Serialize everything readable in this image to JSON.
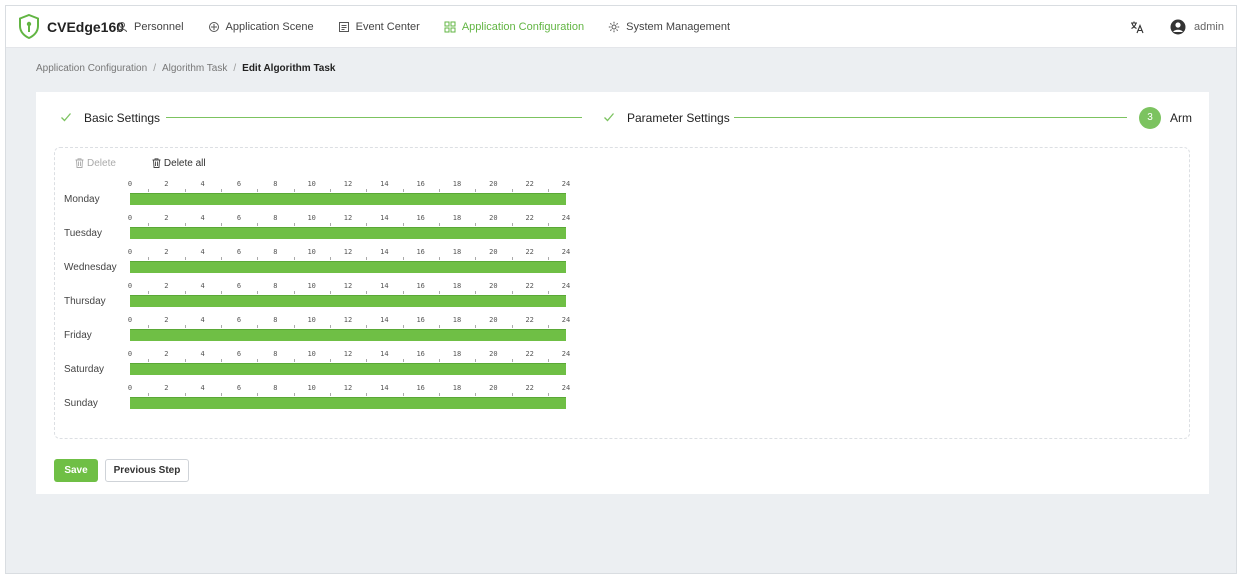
{
  "header": {
    "brand": "CVEdge160",
    "nav": [
      {
        "label": "Personnel",
        "icon": "person-icon",
        "active": false
      },
      {
        "label": "Application Scene",
        "icon": "scene-icon",
        "active": false
      },
      {
        "label": "Event Center",
        "icon": "event-icon",
        "active": false
      },
      {
        "label": "Application Configuration",
        "icon": "grid-icon",
        "active": true
      },
      {
        "label": "System Management",
        "icon": "gear-icon",
        "active": false
      }
    ],
    "user": "admin"
  },
  "breadcrumb": {
    "items": [
      "Application Configuration",
      "Algorithm Task"
    ],
    "current": "Edit Algorithm Task",
    "separator": "/"
  },
  "steps": [
    {
      "label": "Basic Settings",
      "status": "done"
    },
    {
      "label": "Parameter Settings",
      "status": "done"
    },
    {
      "label": "Arm",
      "number": "3",
      "status": "active"
    }
  ],
  "schedule": {
    "toolbar": {
      "delete": "Delete",
      "delete_all": "Delete all"
    },
    "tick_labels": [
      "0",
      "2",
      "4",
      "6",
      "8",
      "10",
      "12",
      "14",
      "16",
      "18",
      "20",
      "22",
      "24"
    ],
    "days": [
      {
        "label": "Monday",
        "armed_from": 0,
        "armed_to": 24
      },
      {
        "label": "Tuesday",
        "armed_from": 0,
        "armed_to": 24
      },
      {
        "label": "Wednesday",
        "armed_from": 0,
        "armed_to": 24
      },
      {
        "label": "Thursday",
        "armed_from": 0,
        "armed_to": 24
      },
      {
        "label": "Friday",
        "armed_from": 0,
        "armed_to": 24
      },
      {
        "label": "Saturday",
        "armed_from": 0,
        "armed_to": 24
      },
      {
        "label": "Sunday",
        "armed_from": 0,
        "armed_to": 24
      }
    ]
  },
  "actions": {
    "save": "Save",
    "previous": "Previous Step"
  },
  "colors": {
    "accent": "#6fbf45",
    "step_line": "#7cc360",
    "nav_active": "#62b543"
  }
}
